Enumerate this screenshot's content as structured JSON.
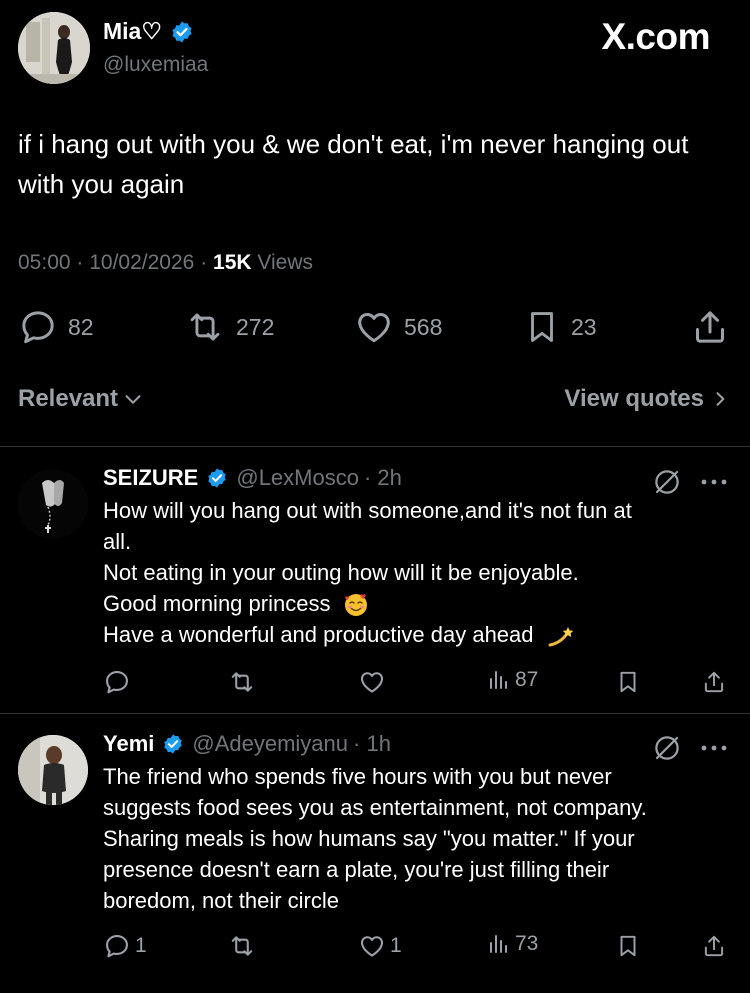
{
  "site_badge": "X.com",
  "tweet": {
    "name": "Mia♡",
    "handle": "@luxemiaa",
    "text": "if i hang out with you & we don't eat, i'm never hanging out with you again",
    "time": "05:00",
    "date": "10/02/2026",
    "views_count": "15K",
    "views_label": "Views",
    "replies": "82",
    "reposts": "272",
    "likes": "568",
    "bookmarks": "23"
  },
  "sort": {
    "left_label": "Relevant",
    "right_label": "View quotes"
  },
  "replies": [
    {
      "name": "SEIZURE",
      "handle": "@LexMosco",
      "age": "· 2h",
      "lines": [
        "How will you hang out with someone,and it's not fun at",
        "all.",
        "Not eating in your outing how will it be enjoyable.",
        "Good morning princess",
        "Have a wonderful and productive day ahead"
      ],
      "replies": "",
      "reposts": "",
      "likes": "",
      "views": "87"
    },
    {
      "name": "Yemi",
      "handle": "@Adeyemiyanu",
      "age": "· 1h",
      "lines": [
        "The friend who spends five hours with you but never",
        "suggests food sees you as entertainment, not company.",
        "Sharing meals is how humans say \"you matter.\" If your",
        "presence doesn't earn a plate, you're just filling their",
        "boredom, not their circle"
      ],
      "replies": "1",
      "reposts": "",
      "likes": "1",
      "views": "73"
    }
  ],
  "colors": {
    "background": "#000000",
    "text": "#e7e9ea",
    "muted": "#71767b",
    "verified": "#1d9bf0",
    "divider": "#2f3336"
  }
}
